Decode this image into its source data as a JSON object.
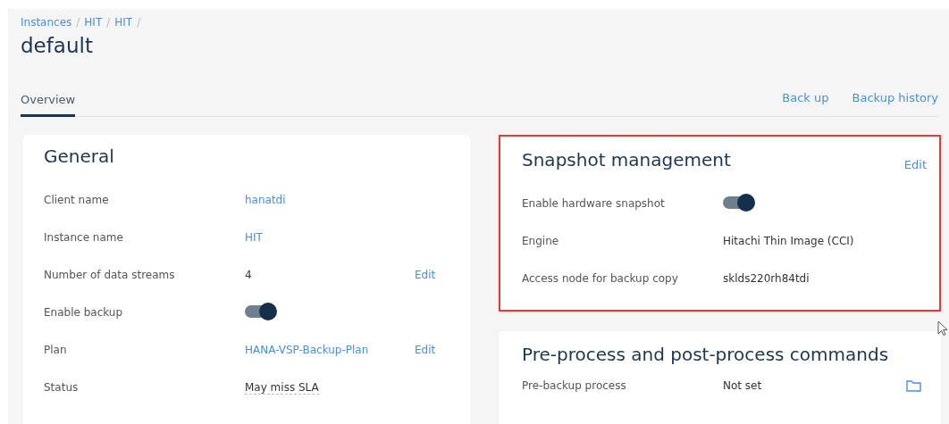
{
  "breadcrumb": [
    {
      "label": "Instances",
      "separator": "/"
    },
    {
      "label": "HIT",
      "separator": "/"
    },
    {
      "label": "HIT",
      "separator": "/"
    }
  ],
  "title": "default",
  "tabs": [
    {
      "label": "Overview",
      "selected": true
    }
  ],
  "actions": [
    "Back up",
    "Backup history"
  ],
  "general": {
    "title": "General",
    "rows": [
      {
        "label": "Client name",
        "kind": "link",
        "value": "hanatdi"
      },
      {
        "label": "Instance name",
        "kind": "link",
        "value": "HIT"
      },
      {
        "label": "Number of data streams",
        "kind": "text",
        "value": "4",
        "edit": "Edit"
      },
      {
        "label": "Enable backup",
        "kind": "toggle",
        "on": true
      },
      {
        "label": "Plan",
        "kind": "link",
        "value": "HANA-VSP-Backup-Plan",
        "edit": "Edit"
      },
      {
        "label": "Status",
        "kind": "text",
        "value": "May miss SLA"
      }
    ]
  },
  "snapshot": {
    "title": "Snapshot management",
    "edit": "Edit",
    "highlighted": true,
    "rows": [
      {
        "label": "Enable hardware snapshot",
        "kind": "toggle",
        "on": true
      },
      {
        "label": "Engine",
        "kind": "text",
        "value": "Hitachi Thin Image (CCI)"
      },
      {
        "label": "Access node for backup copy",
        "kind": "text",
        "value": "sklds220rh84tdi"
      }
    ]
  },
  "commands": {
    "title": "Pre-process and post-process commands",
    "rows": [
      {
        "label": "Pre-backup process",
        "kind": "text",
        "value": "Not set"
      }
    ]
  }
}
